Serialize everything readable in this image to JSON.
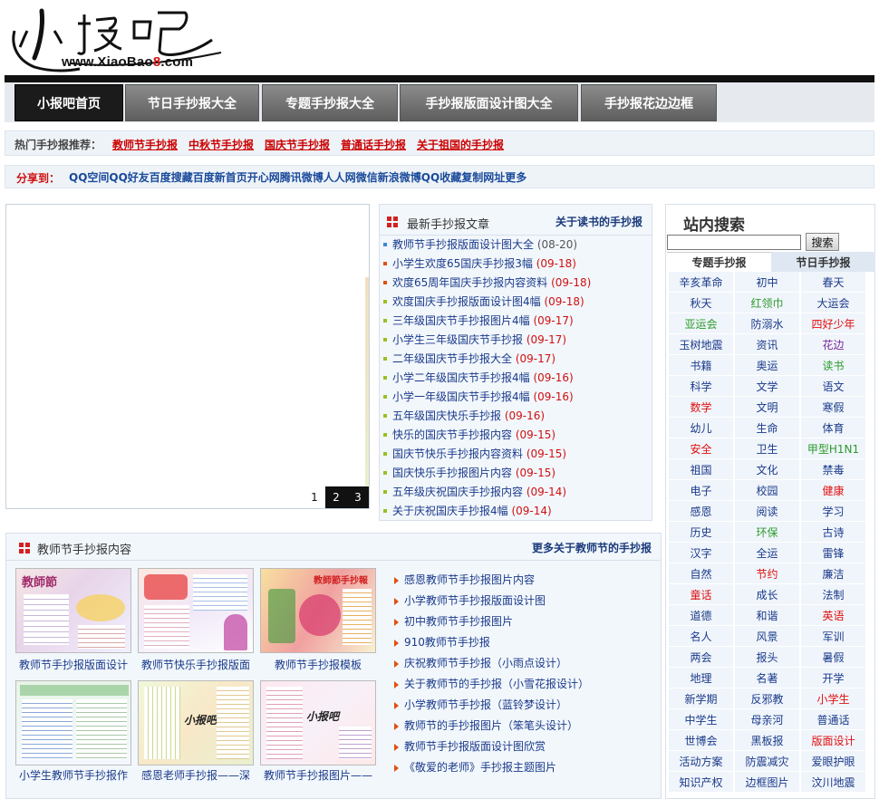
{
  "logo": {
    "domain_prefix": "www.",
    "domain_main": "XiaoBao",
    "domain_num": "8",
    "domain_suffix": ".com"
  },
  "nav": [
    "小报吧首页",
    "节日手抄报大全",
    "专题手抄报大全",
    "手抄报版面设计图大全",
    "手抄报花边边框"
  ],
  "hot": {
    "label": "热门手抄报推荐：",
    "links": [
      "教师节手抄报",
      "中秋节手抄报",
      "国庆节手抄报",
      "普通话手抄报",
      "关于祖国的手抄报"
    ]
  },
  "share": {
    "label": "分享到：",
    "links": "QQ空间QQ好友百度搜藏百度新首页开心网腾讯微博人人网微信新浪微博QQ收藏复制网址更多"
  },
  "slideshow": {
    "pages": [
      "1",
      "2",
      "3"
    ]
  },
  "latest": {
    "title": "最新手抄报文章",
    "more": "关于读书的手抄报",
    "items": [
      {
        "title": "教师节手抄报版面设计图大全",
        "date": "(08-20)",
        "bullet": "#3a8ad8"
      },
      {
        "title": "小学生欢度65国庆手抄报3幅",
        "date": "(09-18)",
        "bullet": "#e05010"
      },
      {
        "title": "欢度65周年国庆手抄报内容资料",
        "date": "(09-18)",
        "bullet": "#e05010"
      },
      {
        "title": "欢度国庆手抄报版面设计图4幅",
        "date": "(09-18)",
        "bullet": "#9ac020"
      },
      {
        "title": "三年级国庆节手抄报图片4幅",
        "date": "(09-17)",
        "bullet": "#9ac020"
      },
      {
        "title": "小学生三年级国庆节手抄报",
        "date": "(09-17)",
        "bullet": "#9ac020"
      },
      {
        "title": "二年级国庆节手抄报大全",
        "date": "(09-17)",
        "bullet": "#9ac020"
      },
      {
        "title": "小学二年级国庆节手抄报4幅",
        "date": "(09-16)",
        "bullet": "#9ac020"
      },
      {
        "title": "小学一年级国庆节手抄报4幅",
        "date": "(09-16)",
        "bullet": "#9ac020"
      },
      {
        "title": "五年级国庆快乐手抄报",
        "date": "(09-16)",
        "bullet": "#9ac020"
      },
      {
        "title": "快乐的国庆节手抄报内容",
        "date": "(09-15)",
        "bullet": "#9ac020"
      },
      {
        "title": "国庆节快乐手抄报内容资料",
        "date": "(09-15)",
        "bullet": "#9ac020"
      },
      {
        "title": "国庆快乐手抄报图片内容",
        "date": "(09-15)",
        "bullet": "#9ac020"
      },
      {
        "title": "五年级庆祝国庆手抄报内容",
        "date": "(09-14)",
        "bullet": "#9ac020"
      },
      {
        "title": "关于庆祝国庆手抄报4幅",
        "date": "(09-14)",
        "bullet": "#9ac020"
      }
    ]
  },
  "teachers": {
    "title": "教师节手抄报内容",
    "more": "更多关于教师节的手抄报",
    "thumbs": [
      {
        "caption": "教师节手抄报版面设计",
        "art": "教師節"
      },
      {
        "caption": "教师节快乐手抄报版面",
        "art": ""
      },
      {
        "caption": "教师节手抄报模板",
        "art": "教師節手抄報"
      },
      {
        "caption": "小学生教师节手抄报作",
        "art": ""
      },
      {
        "caption": "感恩老师手抄报——深",
        "art": "小报吧"
      },
      {
        "caption": "教师节手抄报图片——",
        "art": "小报吧"
      }
    ],
    "list": [
      "感恩教师节手抄报图片内容",
      "小学教师节手抄报版面设计图",
      "初中教师节手抄报图片",
      "910教师节手抄报",
      "庆祝教师节手抄报（小雨点设计）",
      "关于教师节的手抄报（小雪花报设计）",
      "小学教师节手抄报（蓝铃梦设计）",
      "教师节的手抄报图片（笨笔头设计）",
      "教师节手抄报版面设计图欣赏",
      "《敬爱的老师》手抄报主题图片"
    ]
  },
  "sidebar": {
    "title": "站内搜索",
    "search_value": "",
    "search_button": "搜索",
    "tabs": [
      "专题手抄报",
      "节日手抄报"
    ],
    "tags": [
      {
        "t": "辛亥革命",
        "c": "blue"
      },
      {
        "t": "初中",
        "c": "blue"
      },
      {
        "t": "春天",
        "c": "blue"
      },
      {
        "t": "秋天",
        "c": "blue"
      },
      {
        "t": "红领巾",
        "c": "green"
      },
      {
        "t": "大运会",
        "c": "blue"
      },
      {
        "t": "亚运会",
        "c": "green"
      },
      {
        "t": "防溺水",
        "c": "blue"
      },
      {
        "t": "四好少年",
        "c": "red"
      },
      {
        "t": "玉树地震",
        "c": "blue"
      },
      {
        "t": "资讯",
        "c": "blue"
      },
      {
        "t": "花边",
        "c": "purple"
      },
      {
        "t": "书籍",
        "c": "blue"
      },
      {
        "t": "奥运",
        "c": "blue"
      },
      {
        "t": "读书",
        "c": "green"
      },
      {
        "t": "科学",
        "c": "blue"
      },
      {
        "t": "文学",
        "c": "blue"
      },
      {
        "t": "语文",
        "c": "blue"
      },
      {
        "t": "数学",
        "c": "red"
      },
      {
        "t": "文明",
        "c": "blue"
      },
      {
        "t": "寒假",
        "c": "blue"
      },
      {
        "t": "幼儿",
        "c": "blue"
      },
      {
        "t": "生命",
        "c": "blue"
      },
      {
        "t": "体育",
        "c": "blue"
      },
      {
        "t": "安全",
        "c": "red"
      },
      {
        "t": "卫生",
        "c": "blue"
      },
      {
        "t": "甲型H1N1",
        "c": "green"
      },
      {
        "t": "祖国",
        "c": "blue"
      },
      {
        "t": "文化",
        "c": "blue"
      },
      {
        "t": "禁毒",
        "c": "blue"
      },
      {
        "t": "电子",
        "c": "blue"
      },
      {
        "t": "校园",
        "c": "blue"
      },
      {
        "t": "健康",
        "c": "red"
      },
      {
        "t": "感恩",
        "c": "blue"
      },
      {
        "t": "阅读",
        "c": "blue"
      },
      {
        "t": "学习",
        "c": "blue"
      },
      {
        "t": "历史",
        "c": "blue"
      },
      {
        "t": "环保",
        "c": "green"
      },
      {
        "t": "古诗",
        "c": "blue"
      },
      {
        "t": "汉字",
        "c": "blue"
      },
      {
        "t": "全运",
        "c": "blue"
      },
      {
        "t": "雷锋",
        "c": "blue"
      },
      {
        "t": "自然",
        "c": "blue"
      },
      {
        "t": "节约",
        "c": "red"
      },
      {
        "t": "廉洁",
        "c": "blue"
      },
      {
        "t": "童话",
        "c": "red"
      },
      {
        "t": "成长",
        "c": "blue"
      },
      {
        "t": "法制",
        "c": "blue"
      },
      {
        "t": "道德",
        "c": "blue"
      },
      {
        "t": "和谐",
        "c": "blue"
      },
      {
        "t": "英语",
        "c": "red"
      },
      {
        "t": "名人",
        "c": "blue"
      },
      {
        "t": "风景",
        "c": "blue"
      },
      {
        "t": "军训",
        "c": "blue"
      },
      {
        "t": "两会",
        "c": "blue"
      },
      {
        "t": "报头",
        "c": "blue"
      },
      {
        "t": "暑假",
        "c": "blue"
      },
      {
        "t": "地理",
        "c": "blue"
      },
      {
        "t": "名著",
        "c": "blue"
      },
      {
        "t": "开学",
        "c": "blue"
      },
      {
        "t": "新学期",
        "c": "blue"
      },
      {
        "t": "反邪教",
        "c": "blue"
      },
      {
        "t": "小学生",
        "c": "red"
      },
      {
        "t": "中学生",
        "c": "blue"
      },
      {
        "t": "母亲河",
        "c": "blue"
      },
      {
        "t": "普通话",
        "c": "blue"
      },
      {
        "t": "世博会",
        "c": "blue"
      },
      {
        "t": "黑板报",
        "c": "blue"
      },
      {
        "t": "版面设计",
        "c": "red"
      },
      {
        "t": "活动方案",
        "c": "blue"
      },
      {
        "t": "防震减灾",
        "c": "blue"
      },
      {
        "t": "爱眼护眼",
        "c": "blue"
      },
      {
        "t": "知识产权",
        "c": "blue"
      },
      {
        "t": "边框图片",
        "c": "blue"
      },
      {
        "t": "汶川地震",
        "c": "blue"
      }
    ]
  }
}
